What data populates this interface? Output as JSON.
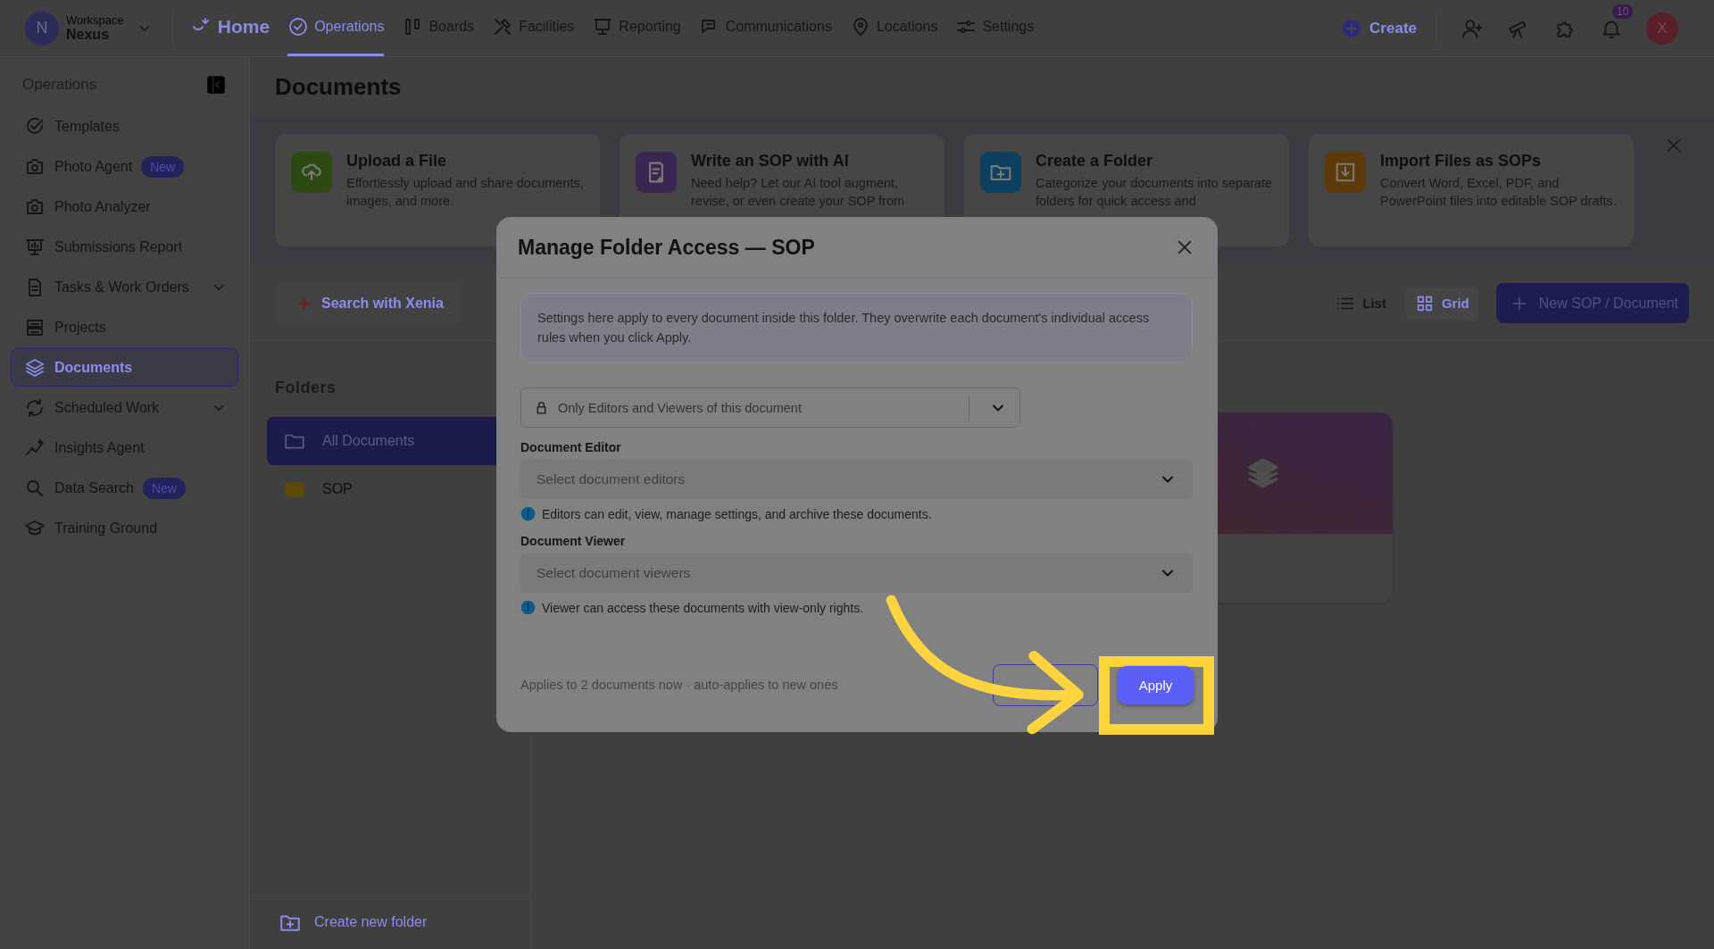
{
  "workspace": {
    "label": "Workspace",
    "name": "Nexus",
    "avatar": "N"
  },
  "nav": [
    {
      "label": "Home",
      "kind": "home",
      "selected": false
    },
    {
      "label": "Operations",
      "kind": "link",
      "selected": true
    },
    {
      "label": "Boards",
      "kind": "link",
      "selected": false
    },
    {
      "label": "Facilities",
      "kind": "link",
      "selected": false
    },
    {
      "label": "Reporting",
      "kind": "link",
      "selected": false
    },
    {
      "label": "Communications",
      "kind": "link",
      "selected": false
    },
    {
      "label": "Locations",
      "kind": "link",
      "selected": false
    },
    {
      "label": "Settings",
      "kind": "link",
      "selected": false
    }
  ],
  "actions": {
    "create": "Create",
    "notifications": "10",
    "avatar": "X"
  },
  "sidebar": {
    "title": "Operations",
    "items": [
      {
        "label": "Templates",
        "expandable": false,
        "selected": false
      },
      {
        "label": "Photo Agent",
        "badge": "New",
        "expandable": false,
        "selected": false
      },
      {
        "label": "Photo Analyzer",
        "expandable": false,
        "selected": false
      },
      {
        "label": "Submissions Report",
        "expandable": false,
        "selected": false
      },
      {
        "label": "Tasks & Work Orders",
        "expandable": true,
        "selected": false
      },
      {
        "label": "Projects",
        "expandable": false,
        "selected": false
      },
      {
        "label": "Documents",
        "expandable": false,
        "selected": true
      },
      {
        "label": "Scheduled Work",
        "expandable": true,
        "selected": false
      },
      {
        "label": "Insights Agent",
        "expandable": false,
        "selected": false
      },
      {
        "label": "Data Search",
        "badge": "New",
        "expandable": false,
        "selected": false
      },
      {
        "label": "Training Ground",
        "expandable": false,
        "selected": false
      }
    ]
  },
  "page": {
    "title": "Documents"
  },
  "promo_cards": [
    {
      "title": "Upload a File",
      "text": "Effortlessly upload and share documents, images, and more.",
      "color": "#2d4a12"
    },
    {
      "title": "Write an SOP with AI",
      "text": "Need help? Let our AI tool augment, revise, or even create your SOP from",
      "color": "#3a2650"
    },
    {
      "title": "Create a Folder",
      "text": "Categorize your documents into separate folders for quick access and",
      "color": "#0d3f5e"
    },
    {
      "title": "Import Files as SOPs",
      "text": "Convert Word, Excel, PDF, and PowerPoint files into editable SOP drafts.",
      "color": "#5e3a0a"
    }
  ],
  "toolbar": {
    "search": "Search with Xenia",
    "views": [
      {
        "label": "List",
        "selected": false
      },
      {
        "label": "Grid",
        "selected": true
      }
    ],
    "new_button": "New SOP / Document"
  },
  "folders": {
    "title": "Folders",
    "items": [
      {
        "label": "All Documents",
        "selected": true
      },
      {
        "label": "SOP",
        "selected": false
      }
    ],
    "create": "Create new folder"
  },
  "modal": {
    "title": "Manage Folder Access — SOP",
    "notice": "Settings here apply to every document inside this folder. They overwrite each document's individual access rules when you click Apply.",
    "access": "Only Editors and Viewers of this document",
    "fields": [
      {
        "label": "Document Editor",
        "placeholder": "Select document editors",
        "hint": "Editors can edit, view, manage settings, and archive these documents."
      },
      {
        "label": "Document Viewer",
        "placeholder": "Select document viewers",
        "hint": "Viewer can access these documents with view-only rights."
      }
    ],
    "footer": "Applies to 2 documents now · auto-applies to new ones",
    "apply": "Apply"
  }
}
